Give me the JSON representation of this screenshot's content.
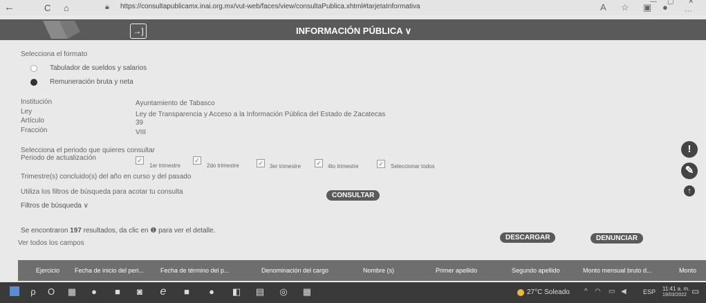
{
  "browser": {
    "url": "https://consultapublicamx.inai.org.mx/vut-web/faces/view/consultaPublica.xhtml#tarjetaInformativa",
    "back_glyph": "←",
    "refresh_glyph": "C",
    "home_glyph": "⌂",
    "minimize_glyph": "—",
    "restore_glyph": "▢",
    "close_glyph": "✕",
    "more_glyph": "···"
  },
  "header": {
    "title": "INFORMACIÓN PÚBLICA ∨",
    "exit_glyph": "→]"
  },
  "format": {
    "label": "Selecciona el formato",
    "options": [
      {
        "label": "Tabulador de sueldos y salarios",
        "selected": false
      },
      {
        "label": "Remuneración bruta y neta",
        "selected": true
      }
    ]
  },
  "info": {
    "institucion_label": "Institución",
    "institucion_value": "Ayuntamiento de Tabasco",
    "ley_label": "Ley",
    "ley_value": "Ley de Transparencia y Acceso a la Información Pública del Estado de Zacatecas",
    "articulo_label": "Artículo",
    "articulo_value": "39",
    "fraccion_label": "Fracción",
    "fraccion_value": "VIII"
  },
  "period": {
    "label1": "Selecciona el periodo que quieres consultar",
    "label2": "Periodo de actualización",
    "checkboxes": [
      "1er trimestre",
      "2do trimestre",
      "3er trimestre",
      "4to trimestre",
      "Seleccionar todos"
    ],
    "check_glyph": "✓",
    "note": "Trimestre(s) concluido(s) del año en curso y del pasado"
  },
  "filters": {
    "hint": "Utiliza los filtros de búsqueda para acotar tu consulta",
    "consult_button": "CONSULTAR",
    "toggle": "Filtros de búsqueda ∨"
  },
  "results": {
    "text_prefix": "Se encontraron ",
    "count": "197",
    "text_suffix": " resultados, da clic en ",
    "info_glyph": "❶",
    "text_end": " para ver el detalle.",
    "all_fields": "Ver todos los campos",
    "download_button": "DESCARGAR",
    "report_button": "DENUNCIAR"
  },
  "side": {
    "alert_glyph": "!",
    "tool_glyph": "✎",
    "up_glyph": "↑"
  },
  "table": {
    "headers": [
      "Ejercicio",
      "Fecha de inicio del peri...",
      "Fecha de término del p...",
      "Denominación del cargo",
      "Nombre (s)",
      "Primer apellido",
      "Segundo apellido",
      "Monto mensual bruto d...",
      "Monto"
    ]
  },
  "taskbar": {
    "weather": "27°C Soleado",
    "lang": "ESP",
    "time": "11:41 a. m.",
    "date": "19/03/2022",
    "icons": [
      "ρ",
      "O",
      "▦",
      "●",
      "■",
      "◙",
      "e",
      "■",
      "●",
      "◧",
      "▤",
      "◎",
      "▦"
    ]
  },
  "colors": {
    "header_band": "#5a5a5a",
    "table_header": "#6e6e6e",
    "pill": "#5a5a5a"
  }
}
